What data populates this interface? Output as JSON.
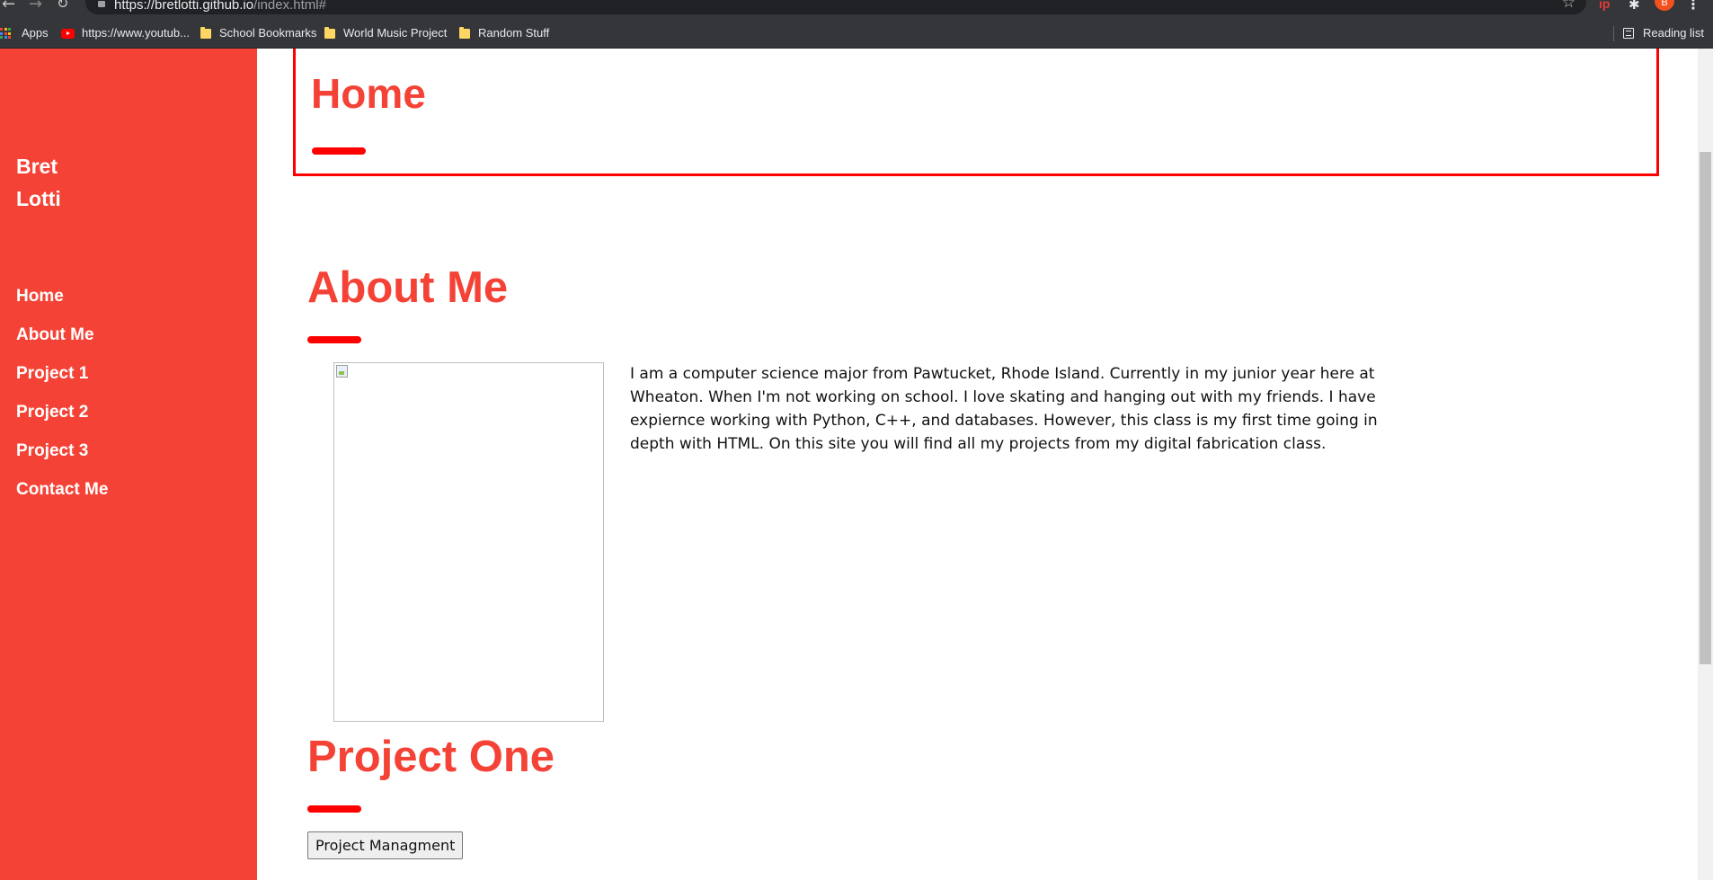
{
  "browser": {
    "url_host": "https://bretlotti.github.io",
    "url_path": "/index.html#",
    "bookmarks": {
      "apps": "Apps",
      "youtube": "https://www.youtub...",
      "school": "School Bookmarks",
      "music": "World Music Project",
      "random": "Random Stuff",
      "reading_list": "Reading list"
    },
    "profile_initial": "B"
  },
  "sidebar": {
    "brand_first": "Bret",
    "brand_last": "Lotti",
    "nav": [
      {
        "label": "Home"
      },
      {
        "label": "About Me"
      },
      {
        "label": "Project 1"
      },
      {
        "label": "Project 2"
      },
      {
        "label": "Project 3"
      },
      {
        "label": "Contact Me"
      }
    ]
  },
  "home": {
    "title": "Home"
  },
  "about": {
    "title": "About Me",
    "text": "I am a computer science major from Pawtucket, Rhode Island. Currently in my junior year here at Wheaton. When I'm not working on school. I love skating and hanging out with my friends. I have expiernce working with Python, C++, and databases. However, this class is my first time going in depth with HTML. On this site you will find all my projects from my digital fabrication class."
  },
  "project_one": {
    "title": "Project One",
    "button_label": "Project Managment"
  },
  "colors": {
    "sidebar_bg": "#f44336",
    "accent": "#ff0000",
    "heading": "#f44336"
  },
  "icons": {
    "back": "back-arrow-icon",
    "forward": "forward-arrow-icon",
    "reload": "reload-icon",
    "lock": "lock-icon",
    "star": "star-icon",
    "extensions": "puzzle-icon",
    "menu": "kebab-menu-icon",
    "apps": "apps-grid-icon",
    "youtube": "youtube-icon",
    "folder": "folder-icon",
    "reading_list": "reading-list-icon",
    "image_missing": "broken-image-icon"
  }
}
